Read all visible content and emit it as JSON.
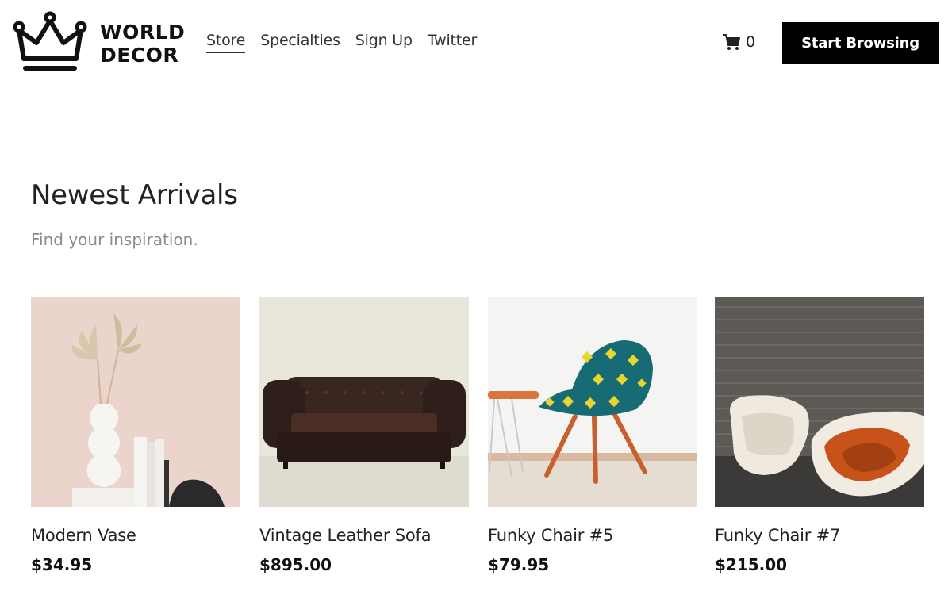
{
  "brand": {
    "line1": "WORLD",
    "line2": "DECOR",
    "logo_icon": "crown-icon"
  },
  "nav": {
    "items": [
      {
        "label": "Store",
        "active": true
      },
      {
        "label": "Specialties",
        "active": false
      },
      {
        "label": "Sign Up",
        "active": false
      },
      {
        "label": "Twitter",
        "active": false
      }
    ]
  },
  "cart": {
    "icon": "cart-icon",
    "count": "0"
  },
  "cta": {
    "label": "Start Browsing",
    "background": "#000000",
    "color": "#ffffff"
  },
  "main": {
    "title": "Newest Arrivals",
    "subtitle": "Find your inspiration."
  },
  "products": [
    {
      "name": "Modern Vase",
      "price": "$34.95"
    },
    {
      "name": "Vintage Leather Sofa",
      "price": "$895.00"
    },
    {
      "name": "Funky Chair #5",
      "price": "$79.95"
    },
    {
      "name": "Funky Chair #7",
      "price": "$215.00"
    }
  ]
}
